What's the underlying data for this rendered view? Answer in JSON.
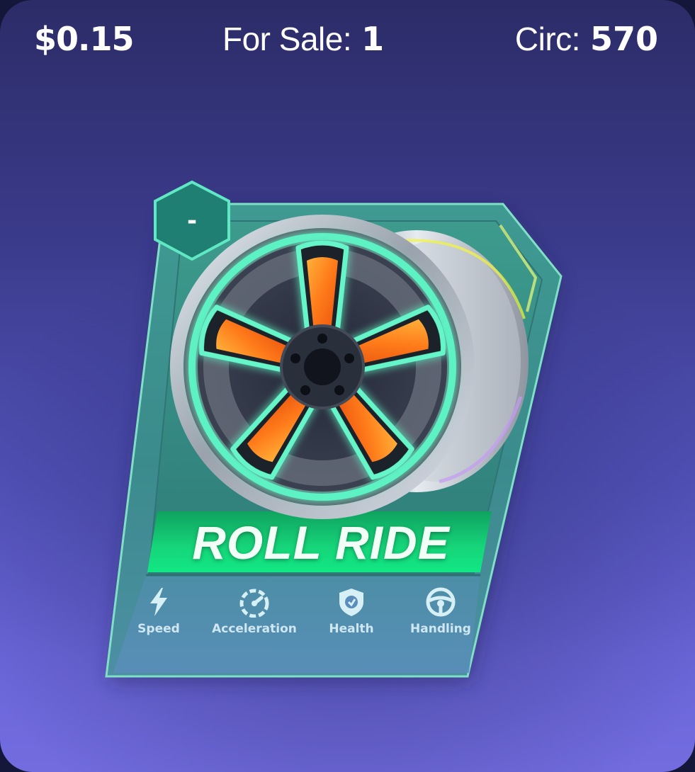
{
  "header": {
    "price": "$0.15",
    "for_sale_label": "For Sale:",
    "for_sale_value": "1",
    "circ_label": "Circ:",
    "circ_value": "570"
  },
  "card": {
    "name": "ROLL RIDE",
    "badge": "-",
    "image": "wheel-rim-icon",
    "stats": [
      {
        "label": "Speed",
        "icon": "lightning-bolt-icon"
      },
      {
        "label": "Acceleration",
        "icon": "speedometer-icon"
      },
      {
        "label": "Health",
        "icon": "shield-icon"
      },
      {
        "label": "Handling",
        "icon": "steering-wheel-icon"
      }
    ],
    "colors": {
      "frame": "#3a8f8a",
      "title_band": "#14d97a",
      "glow_accent": "#6ff7d2",
      "spoke_orange": "#ff7a1a"
    }
  },
  "background": {
    "top": "#2c2c68",
    "bottom": "#726cdf"
  }
}
